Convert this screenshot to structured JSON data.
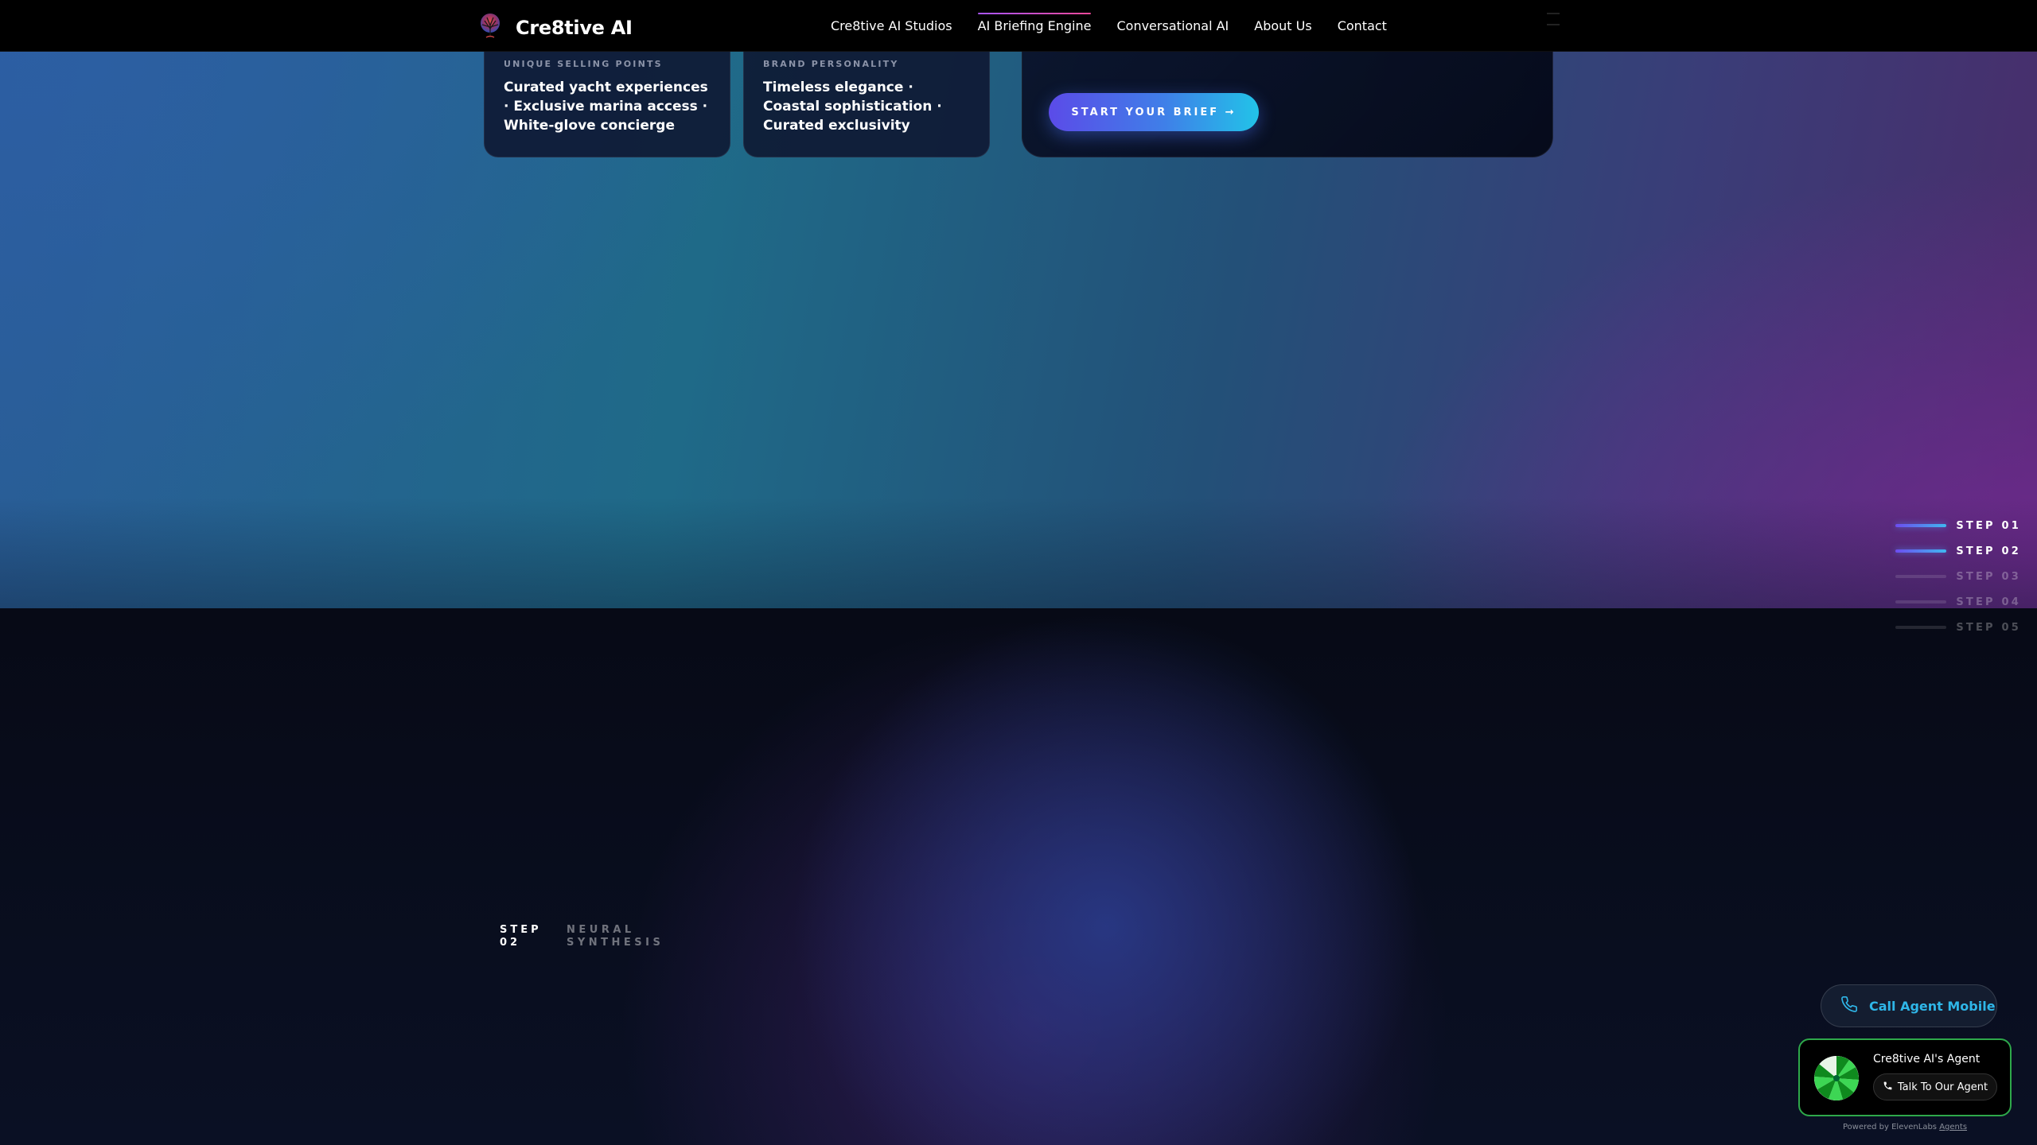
{
  "nav": {
    "brand": "Cre8tive AI",
    "links": [
      {
        "label": "Cre8tive AI Studios"
      },
      {
        "label": "AI Briefing Engine"
      },
      {
        "label": "Conversational AI"
      },
      {
        "label": "About Us"
      },
      {
        "label": "Contact"
      }
    ],
    "active_link": "AI Briefing Engine"
  },
  "cards": {
    "usp": {
      "label": "UNIQUE SELLING POINTS",
      "value": "Curated yacht experiences · Exclusive marina access · White-glove concierge"
    },
    "brand": {
      "label": "BRAND PERSONALITY",
      "value": "Timeless elegance · Coastal sophistication · Curated exclusivity"
    },
    "cta": {
      "button_label": "START YOUR BRIEF →"
    }
  },
  "steps": [
    {
      "label": "STEP 01",
      "state": "done"
    },
    {
      "label": "STEP 02",
      "state": "current"
    },
    {
      "label": "STEP 03",
      "state": "upcoming"
    },
    {
      "label": "STEP 04",
      "state": "upcoming"
    },
    {
      "label": "STEP 05",
      "state": "upcoming"
    }
  ],
  "section": {
    "step_line1": "STEP",
    "step_line2": "02",
    "name_line1": "NEURAL",
    "name_line2": "SYNTHESIS"
  },
  "widgets": {
    "call_mobile_label": "Call Agent Mobile",
    "agent_name": "Cre8tive AI's Agent",
    "talk_label": "Talk To Our Agent",
    "powered_prefix": "Powered by ElevenLabs",
    "powered_link": "Agents"
  },
  "colors": {
    "accent_gradient_start": "#5b4be8",
    "accent_gradient_end": "#22c3e8",
    "call_mobile_text": "#2fb6e8",
    "agent_border": "#2ea84a",
    "nav_active_underline": "#ec4899"
  },
  "icons": {
    "brand": "tree-logo-icon",
    "call_mobile": "phone-outline-icon",
    "talk": "phone-solid-icon",
    "agent_avatar": "green-swirl-avatar"
  }
}
